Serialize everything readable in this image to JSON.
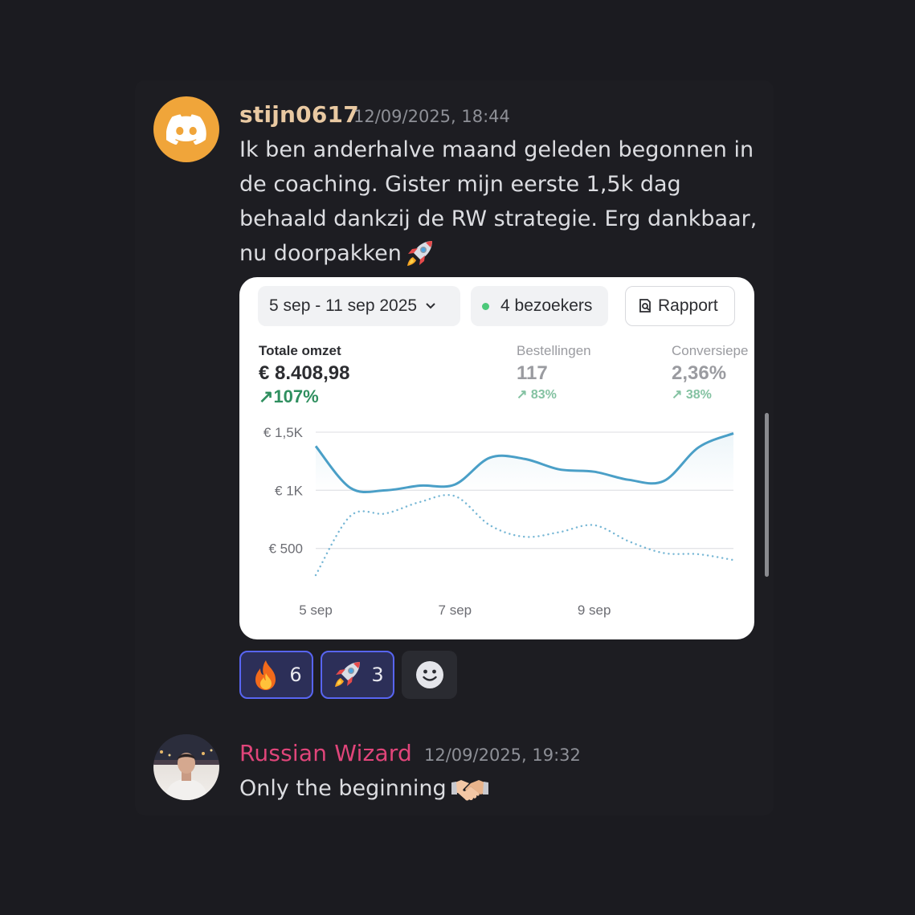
{
  "messages": [
    {
      "username": "stijn0617",
      "username_color": "#e9c9a2",
      "timestamp": "12/09/2025, 18:44",
      "lines": [
        "Ik ben anderhalve maand geleden begonnen in",
        "de coaching. Gister mijn eerste 1,5k dag",
        "behaald dankzij de RW strategie. Erg dankbaar,",
        "nu doorpakken"
      ],
      "avatar_icon": "discord-logo-icon",
      "trailing_emoji": "rocket-icon"
    },
    {
      "username": "Russian Wizard",
      "username_color": "#e0457a",
      "timestamp": "12/09/2025, 19:32",
      "text": "Only the beginning",
      "trailing_emoji": "handshake-icon"
    }
  ],
  "embed": {
    "date_range": "5 sep - 11 sep 2025",
    "visitors": "4 bezoekers",
    "report_button": "Rapport",
    "metrics": [
      {
        "label": "Totale omzet",
        "value": "€ 8.408,98",
        "change": "107%"
      },
      {
        "label": "Bestellingen",
        "value": "117",
        "change": "83%"
      },
      {
        "label": "Conversiepe",
        "value": "2,36%",
        "change": "38%"
      }
    ],
    "accent_color": "#4a9fc7",
    "positive_color": "#2f8f5f"
  },
  "chart_data": {
    "type": "line",
    "y_ticks": [
      "€ 1,5K",
      "€ 1K",
      "€ 500"
    ],
    "x_ticks": [
      "5 sep",
      "7 sep",
      "9 sep"
    ],
    "ylim": [
      0,
      1500
    ],
    "grid": true,
    "series": [
      {
        "style": "solid",
        "x": [
          0,
          0.5,
          1,
          1.5,
          2,
          2.5,
          3,
          3.5,
          4,
          4.5,
          5,
          5.5,
          6
        ],
        "values": [
          1380,
          1020,
          1000,
          1040,
          1050,
          1280,
          1270,
          1180,
          1160,
          1090,
          1080,
          1370,
          1490
        ]
      },
      {
        "style": "dotted",
        "x": [
          0,
          0.5,
          1,
          1.5,
          2,
          2.5,
          3,
          3.5,
          4,
          4.5,
          5,
          5.5,
          6
        ],
        "values": [
          270,
          780,
          800,
          900,
          950,
          700,
          600,
          640,
          700,
          560,
          460,
          450,
          400
        ]
      }
    ]
  },
  "reactions": [
    {
      "emoji": "fire-icon",
      "count": "6"
    },
    {
      "emoji": "rocket-icon",
      "count": "3"
    }
  ],
  "add_reaction": "smiley-add-reaction-icon"
}
